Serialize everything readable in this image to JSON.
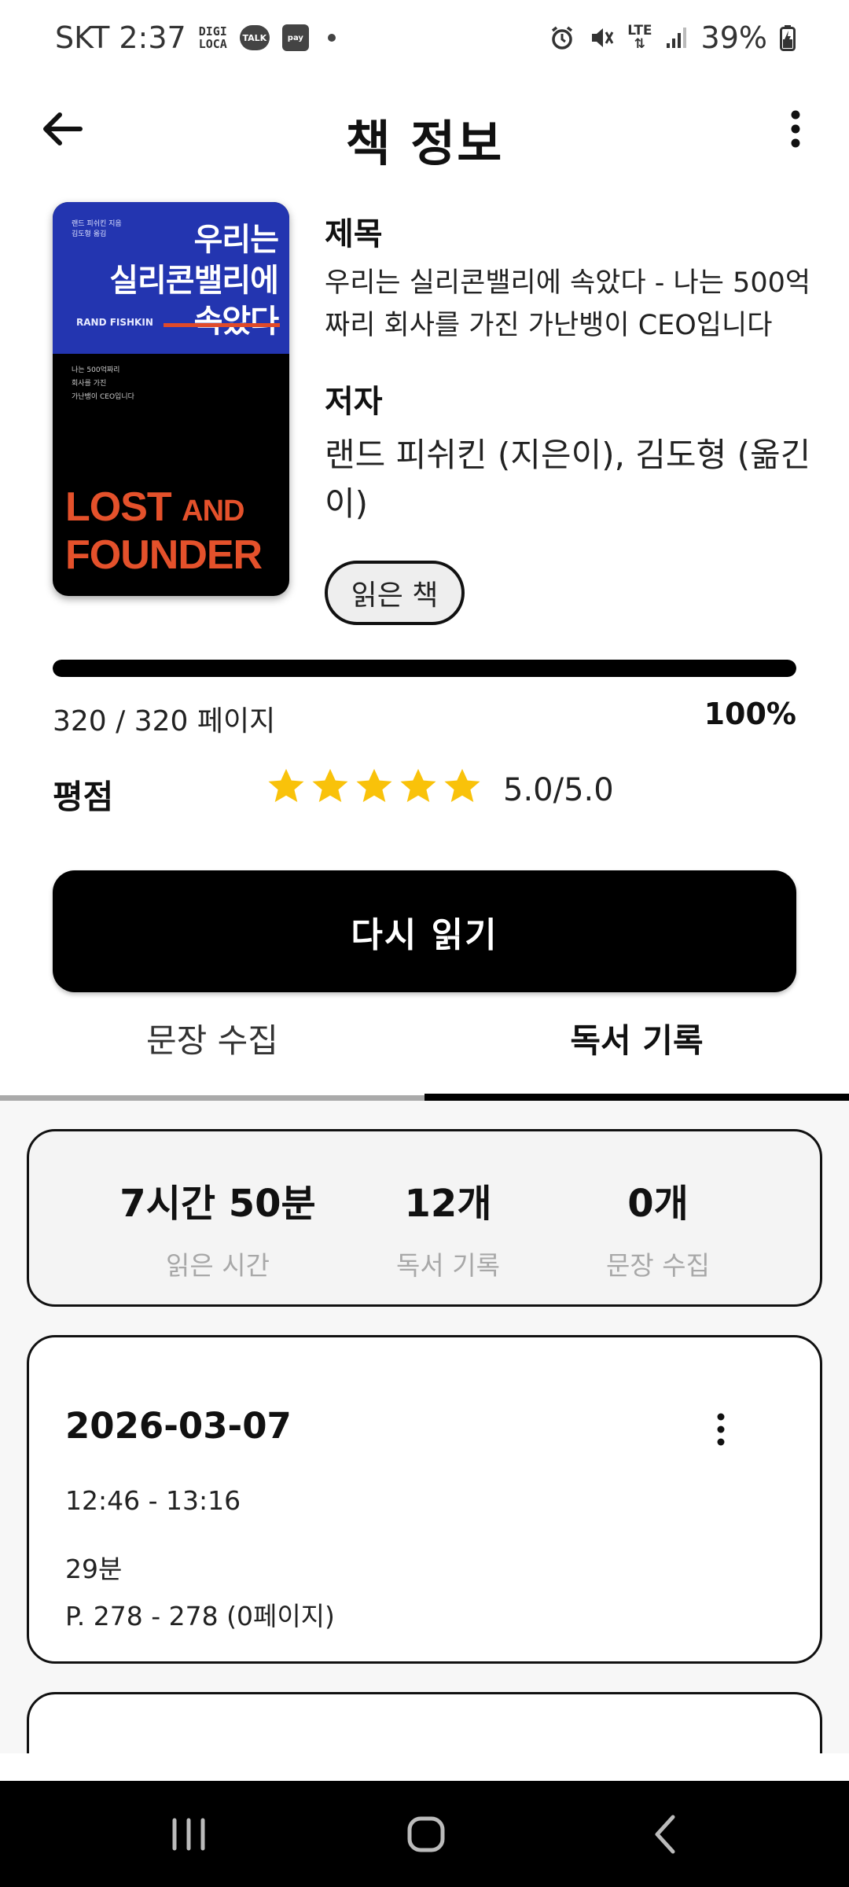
{
  "status_bar": {
    "carrier_time": "SKT 2:37",
    "digi_loca": "DIGI\nLOCA",
    "talk": "TALK",
    "pay": "pay",
    "lte": "LTE",
    "battery": "39%"
  },
  "app_bar": {
    "title": "책 정보"
  },
  "book": {
    "cover": {
      "small_text": "랜드 피쉬킨 지음\n김도형 옮김",
      "title_line1": "우리는",
      "title_line2": "실리콘밸리에",
      "title_line3": "속았다",
      "author_en": "RAND FISHKIN",
      "desc": "나는 500억짜리\n회사를 가진\n가난뱅이 CEO입니다",
      "en_title_1": "LOST",
      "en_title_and": "AND",
      "en_title_2": "FOUNDER"
    },
    "title_label": "제목",
    "title": "우리는 실리콘밸리에 속았다 - 나는 500억짜리 회사를 가진 가난뱅이 CEO입니다",
    "author_label": "저자",
    "author": "랜드 피쉬킨 (지은이), 김도형 (옮긴이)",
    "status": "읽은 책"
  },
  "progress": {
    "pages_text": "320 / 320 페이지",
    "percent_text": "100%",
    "fraction": 1.0
  },
  "rating": {
    "label": "평점",
    "stars": 5,
    "max": 5,
    "value_text": "5.0/5.0",
    "star_color": "#f9c20a"
  },
  "reread_button": "다시 읽기",
  "tabs": [
    {
      "label": "문장 수집",
      "active": false
    },
    {
      "label": "독서 기록",
      "active": true
    }
  ],
  "summary": {
    "reading_time": {
      "value": "7시간 50분",
      "label": "읽은 시간"
    },
    "records": {
      "value": "12개",
      "label": "독서 기록"
    },
    "sentences": {
      "value": "0개",
      "label": "문장 수집"
    }
  },
  "records": [
    {
      "date": "2026-03-07",
      "time": "12:46 - 13:16",
      "duration": "29분",
      "pages": "P. 278 - 278 (0페이지)"
    }
  ]
}
